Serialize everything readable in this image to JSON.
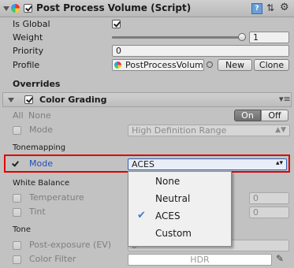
{
  "header": {
    "title": "Post Process Volume (Script)",
    "enabled": true
  },
  "fields": {
    "is_global_label": "Is Global",
    "is_global_checked": true,
    "weight_label": "Weight",
    "weight_value": "1",
    "weight_fraction": 1,
    "priority_label": "Priority",
    "priority_value": "0",
    "profile_label": "Profile",
    "profile_value": "PostProcessVolum",
    "new_button": "New",
    "clone_button": "Clone"
  },
  "overrides": {
    "title": "Overrides",
    "effect_title": "Color Grading",
    "all_label": "All",
    "none_label": "None",
    "on_label": "On",
    "off_label": "Off",
    "mode_label": "Mode",
    "mode_value": "High Definition Range"
  },
  "tonemapping": {
    "section": "Tonemapping",
    "mode_label": "Mode",
    "mode_value": "ACES",
    "highlight_color": "#e00000"
  },
  "white_balance": {
    "section": "White Balance",
    "temperature_label": "Temperature",
    "temperature_value": "0",
    "tint_label": "Tint",
    "tint_value": "0"
  },
  "tone": {
    "section": "Tone",
    "post_exposure_label": "Post-exposure (EV)",
    "post_exposure_value": "0",
    "color_filter_label": "Color Filter",
    "color_filter_value": "HDR"
  },
  "dropdown": {
    "options": [
      "None",
      "Neutral",
      "ACES",
      "Custom"
    ],
    "selected": "ACES",
    "selected_color": "#3a7bd5"
  }
}
